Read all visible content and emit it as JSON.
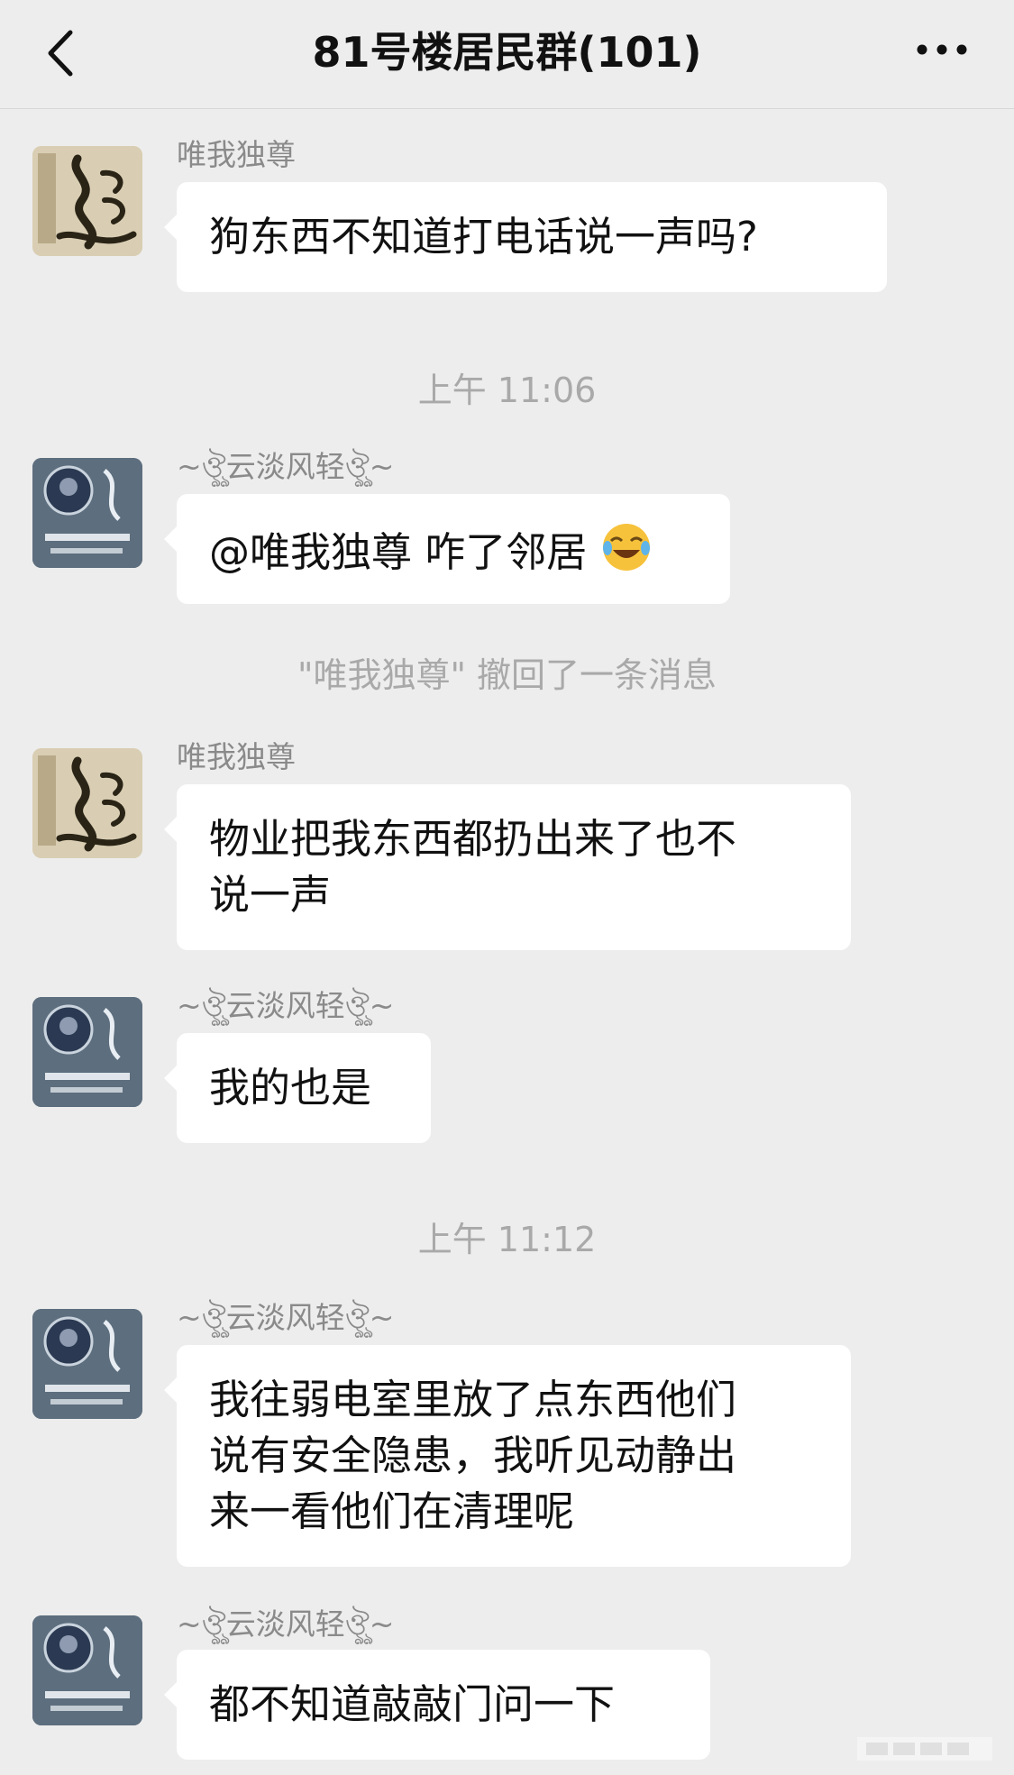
{
  "header": {
    "title": "81号楼居民群(101)",
    "back_icon": "chevron-left-icon",
    "more_icon": "more-dots-icon"
  },
  "messages": [
    {
      "sender": "唯我独尊",
      "text": "狗东西不知道打电话说一声吗?"
    },
    {
      "sender": "~ঔৣ云淡风轻ঔৣ~",
      "text": "@唯我独尊 咋了邻居",
      "emoji": "tears-of-joy-icon"
    },
    {
      "sender": "唯我独尊",
      "lines": [
        "物业把我东西都扔出来了也不",
        "说一声"
      ]
    },
    {
      "sender": "~ঔৣ云淡风轻ঔৣ~",
      "text": "我的也是"
    },
    {
      "sender": "~ঔৣ云淡风轻ঔৣ~",
      "lines": [
        "我往弱电室里放了点东西他们",
        "说有安全隐患，我听见动静出",
        "来一看他们在清理呢"
      ]
    },
    {
      "sender": "~ঔৣ云淡风轻ঔৣ~",
      "text": "都不知道敲敲门问一下"
    }
  ],
  "timestamps": [
    "上午 11:06",
    "上午 11:12"
  ],
  "system_notice": "\"唯我独尊\" 撤回了一条消息",
  "colors": {
    "background": "#ededed",
    "bubble": "#ffffff",
    "meta_text": "#a9a9a9"
  }
}
